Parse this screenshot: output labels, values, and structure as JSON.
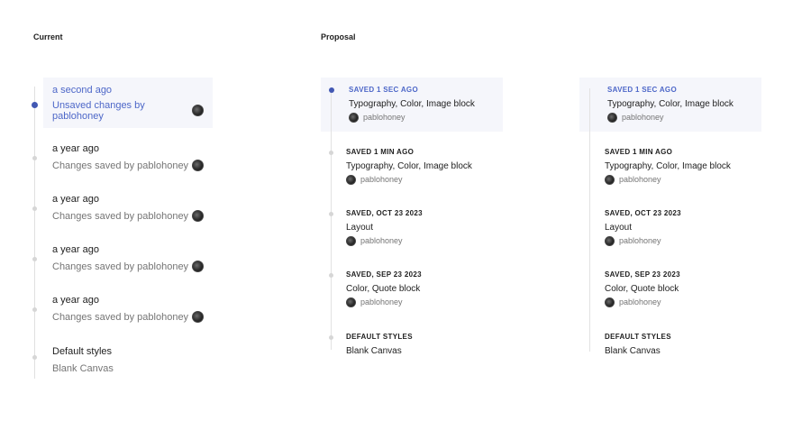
{
  "sections": {
    "current": "Current",
    "proposal": "Proposal"
  },
  "user": "pablohoney",
  "current": {
    "items": [
      {
        "time": "a second ago",
        "desc": "Unsaved changes by pablohoney",
        "active": true
      },
      {
        "time": "a year ago",
        "desc": "Changes saved by pablohoney"
      },
      {
        "time": "a year ago",
        "desc": "Changes saved by pablohoney"
      },
      {
        "time": "a year ago",
        "desc": "Changes saved by pablohoney"
      },
      {
        "time": "a year ago",
        "desc": "Changes saved by pablohoney"
      },
      {
        "time": "Default styles",
        "desc": "Blank Canvas"
      }
    ]
  },
  "proposal": {
    "items": [
      {
        "label": "SAVED 1 SEC AGO",
        "desc": "Typography, Color, Image block",
        "user": "pablohoney"
      },
      {
        "label": "SAVED 1 MIN AGO",
        "desc": "Typography, Color, Image block",
        "user": "pablohoney"
      },
      {
        "label": "SAVED, OCT 23 2023",
        "desc": "Layout",
        "user": "pablohoney"
      },
      {
        "label": "SAVED, SEP 23 2023",
        "desc": "Color, Quote block",
        "user": "pablohoney"
      },
      {
        "label": "DEFAULT STYLES",
        "desc": "Blank Canvas"
      }
    ]
  },
  "colors": {
    "accent": "#4d67c8",
    "highlight_bg": "#f5f6fb",
    "muted": "#757575"
  }
}
